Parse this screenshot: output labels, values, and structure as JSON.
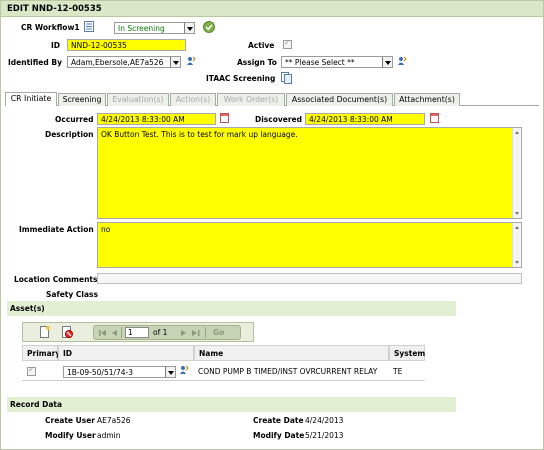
{
  "header": {
    "title": "EDIT NND-12-00535"
  },
  "workflow": {
    "label": "CR Workflow1",
    "status_value": "In Screening"
  },
  "id_field": {
    "label": "ID",
    "value": "NND-12-00535"
  },
  "active": {
    "label": "Active"
  },
  "identified_by": {
    "label": "Identified By",
    "value": "Adam,Ebersole,AE7a526"
  },
  "assign_to": {
    "label": "Assign To",
    "value": "** Please Select **"
  },
  "itaac": {
    "label": "ITAAC Screening"
  },
  "tabs": [
    {
      "label": "CR Initiate",
      "state": "active"
    },
    {
      "label": "Screening",
      "state": "enabled"
    },
    {
      "label": "Evaluation(s)",
      "state": "disabled"
    },
    {
      "label": "Action(s)",
      "state": "disabled"
    },
    {
      "label": "Work Order(s)",
      "state": "disabled"
    },
    {
      "label": "Associated Document(s)",
      "state": "enabled"
    },
    {
      "label": "Attachment(s)",
      "state": "enabled"
    }
  ],
  "occurred": {
    "label": "Occurred",
    "value": "4/24/2013 8:33:00 AM"
  },
  "discovered": {
    "label": "Discovered",
    "value": "4/24/2013 8:33:00 AM"
  },
  "description": {
    "label": "Description",
    "value": "OK Button Test. This is to test for mark up language."
  },
  "immediate_action": {
    "label": "Immediate Action",
    "value": "no"
  },
  "location_comments": {
    "label": "Location Comments",
    "value": ""
  },
  "safety_class": {
    "label": "Safety Class"
  },
  "assets": {
    "section_title": "Asset(s)",
    "pager": {
      "page_value": "1",
      "of_label": "of 1",
      "go_label": "Go"
    },
    "columns": [
      "Primary",
      "ID",
      "Name",
      "System"
    ],
    "rows": [
      {
        "id": "1B-09-50/51/74-3",
        "name": "COND PUMP B TIMED/INST OVRCURRENT RELAY",
        "system": "TE"
      }
    ]
  },
  "record_data": {
    "section_title": "Record Data",
    "create_user_label": "Create User",
    "create_user": "AE7a526",
    "create_date_label": "Create Date",
    "create_date": "4/24/2013",
    "modify_user_label": "Modify User",
    "modify_user": "admin",
    "modify_date_label": "Modify Date",
    "modify_date": "5/21/2013"
  },
  "colors": {
    "field_highlight": "#ffff00",
    "header_bg": "#dbe8c8",
    "section_bg": "#e3efd3"
  },
  "icons": [
    "workflow-list-icon",
    "approve-check-icon",
    "user-picker-icon",
    "itaac-copy-icon",
    "calendar-icon",
    "new-record-icon",
    "delete-record-icon",
    "first-page-icon",
    "prev-page-icon",
    "next-page-icon",
    "last-page-icon"
  ]
}
